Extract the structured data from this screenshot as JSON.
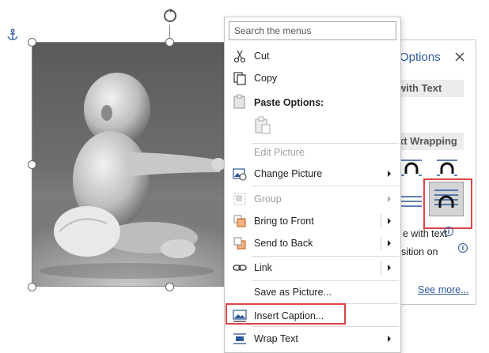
{
  "canvas": {
    "width": 618,
    "height": 447
  },
  "colors": {
    "accent": "#2b579a",
    "highlight_box": "#e04343",
    "menu_border": "#c8c6c4",
    "disabled_text": "#a0a0a0"
  },
  "picture": {
    "description_icon": "photo-black-and-white-baby",
    "anchor_icon": "anchor-icon",
    "rotate_icon": "rotate-handle-icon"
  },
  "context_menu": {
    "search_placeholder": "Search the menus",
    "items": [
      {
        "label": "Cut",
        "icon": "scissors-icon",
        "enabled": true,
        "submenu": false
      },
      {
        "label": "Copy",
        "icon": "copy-icon",
        "enabled": true,
        "submenu": false
      },
      {
        "label": "Paste Options:",
        "icon": "paste-icon",
        "enabled": true,
        "submenu": false
      },
      {
        "label": "Edit Picture",
        "icon": "",
        "enabled": false,
        "submenu": false
      },
      {
        "label": "Change Picture",
        "icon": "change-picture-icon",
        "enabled": true,
        "submenu": true
      },
      {
        "label": "Group",
        "icon": "group-icon",
        "enabled": false,
        "submenu": true
      },
      {
        "label": "Bring to Front",
        "icon": "bring-to-front-icon",
        "enabled": true,
        "submenu": true
      },
      {
        "label": "Send to Back",
        "icon": "send-to-back-icon",
        "enabled": true,
        "submenu": true
      },
      {
        "label": "Link",
        "icon": "link-icon",
        "enabled": true,
        "submenu": true
      },
      {
        "label": "Save as Picture...",
        "icon": "",
        "enabled": true,
        "submenu": false
      },
      {
        "label": "Insert Caption...",
        "icon": "insert-caption-icon",
        "enabled": true,
        "submenu": false,
        "highlighted": true
      },
      {
        "label": "Wrap Text",
        "icon": "wrap-text-icon",
        "enabled": true,
        "submenu": true
      }
    ]
  },
  "layout_options": {
    "title": "Options",
    "close_icon": "close-icon",
    "section_inline": "with Text",
    "section_wrapping": "xt Wrapping",
    "move_with_text": "e with text",
    "fix_position": "osition on",
    "see_more": "See more...",
    "selected_option": "behind-text-icon"
  }
}
